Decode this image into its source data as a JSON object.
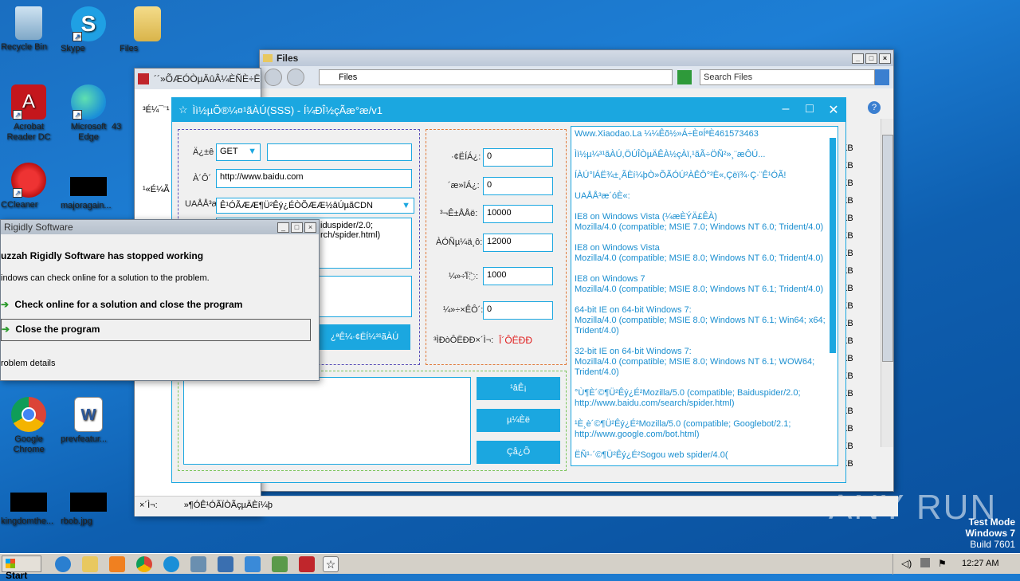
{
  "desktop": {
    "icons": [
      {
        "label": "Recycle Bin"
      },
      {
        "label": "Skype"
      },
      {
        "label": "Files"
      },
      {
        "label": "Acrobat Reader DC"
      },
      {
        "label": "Microsoft Edge"
      },
      {
        "label": "43"
      },
      {
        "label": "CCleaner"
      },
      {
        "label": "majoragain..."
      },
      {
        "label": "Google Chrome"
      },
      {
        "label": "prevfeatur..."
      },
      {
        "label": "kingdomthe..."
      },
      {
        "label": "rbob.jpg"
      }
    ],
    "watermark": "ANY RUN",
    "test_mode": "Test Mode",
    "os_name": "Windows 7",
    "build": "Build 7601"
  },
  "explorer": {
    "title": "Files",
    "address": "Files",
    "search_placeholder": "Search Files",
    "size_unit": "KB"
  },
  "back_window": {
    "title": "´´»ÕÆÓÒµÄûÂ¼ÈÑÈ÷Ë",
    "label1": "³É¼¯¨¹",
    "label2": "¹«É¼Ã",
    "status1": "×´Ì¬:",
    "status2": "»¶Ó­Ê¹ÓÃÏÒÃçµÄÈí¼þ"
  },
  "error_dialog": {
    "title": "Rigidly Software",
    "heading": "uzzah Rigidly Software has stopped working",
    "message": "indows can check online for a solution to the problem.",
    "option1": "Check online for a solution and close the program",
    "option2": "Close the program",
    "details": "roblem details"
  },
  "app": {
    "title": "Ìì½µÕ®¼¤¹ãÀÚ(SSS) - Í¼ÐÎ½çÃæ°æ/v1",
    "method_label": "Ä¿±ê",
    "method_value": "GET",
    "url_label": "À´Ô´",
    "url_value": "http://www.baidu.com",
    "ua_label": "UAÅÅ³æ",
    "ua_select": "Ê¹ÓÃÆÆ¶Ü²Êý¿ÉÒÕÆÆ½âÚµãCDN",
    "ua_text_line1": "iduspider/2.0;",
    "ua_text_line2": "rch/spider.html)",
    "start_button": "¿ªÊ¼·¢ËÍ¼³¹ãÀÚ",
    "fields": [
      {
        "label": "·¢ËÍÁ¿:",
        "value": "0"
      },
      {
        "label": "´æ»îÁ¿:",
        "value": "0"
      },
      {
        "label": "³¬Ê±ÅÅë:",
        "value": "10000"
      },
      {
        "label": "ÀÓÑµ¼ä¸ô:",
        "value": "12000"
      },
      {
        "label": "¼»÷Ï߳̄:",
        "value": "1000"
      },
      {
        "label": "¼»÷×ÊÔ´:",
        "value": "0"
      }
    ],
    "status_label": "³ÌÐòÔËÐÐ×´Ì¬:",
    "status_value": "Î´ÔËÐÐ",
    "btn1": "¹âÊ¡",
    "btn2": "µ¼Èë",
    "btn3": "Çå¿Õ",
    "ua_list": [
      "Www.Xiaodao.La  ¼¼Êõ½»Á÷È¤ÍªÈ461573463",
      "Ìì½µ¼³¹ãÀÚ,ÖÚÎÒµÄÊÀ½çÀï,¹ãÃ÷ÖÑ²»¸¨æÔÚ...",
      "ÍÀÚ°lÁË¾±¸ÃÈí¼þÒ»ÕÃÓÚ²ÀÊÔ°²È«,Çëï¾·Ç·¨Ê¹ÓÃ!",
      "UAÅÅ³æ´óÈ«:",
      "IE8 on Windows Vista (¼æÈÝÄ£ÊÀ)\nMozilla/4.0 (compatible; MSIE 7.0; Windows NT 6.0; Trident/4.0)",
      "IE8 on Windows Vista\nMozilla/4.0 (compatible; MSIE 8.0; Windows NT 6.0; Trident/4.0)",
      "IE8 on Windows 7\nMozilla/4.0 (compatible; MSIE 8.0; Windows NT 6.1; Trident/4.0)",
      "64-bit IE on 64-bit Windows 7:\nMozilla/4.0 (compatible; MSIE 8.0; Windows NT 6.1; Win64; x64;\nTrident/4.0)",
      "32-bit IE on 64-bit Windows 7:\nMozilla/4.0 (compatible; MSIE 8.0; Windows NT 6.1; WOW64;\nTrident/4.0)",
      "°Ù¶È´©¶Ü²Êý¿É²Mozilla/5.0 (compatible; Baiduspider/2.0;\nhttp://www.baidu.com/search/spider.html)",
      "¹È¸è´©¶Ü²Êý¿É²Mozilla/5.0 (compatible; Googlebot/2.1;\nhttp://www.google.com/bot.html)",
      "ËÑ¹·´©¶Ü²Êý¿É²Sogou web spider/4.0("
    ]
  },
  "taskbar": {
    "start": "Start",
    "time": "12:27 AM"
  }
}
